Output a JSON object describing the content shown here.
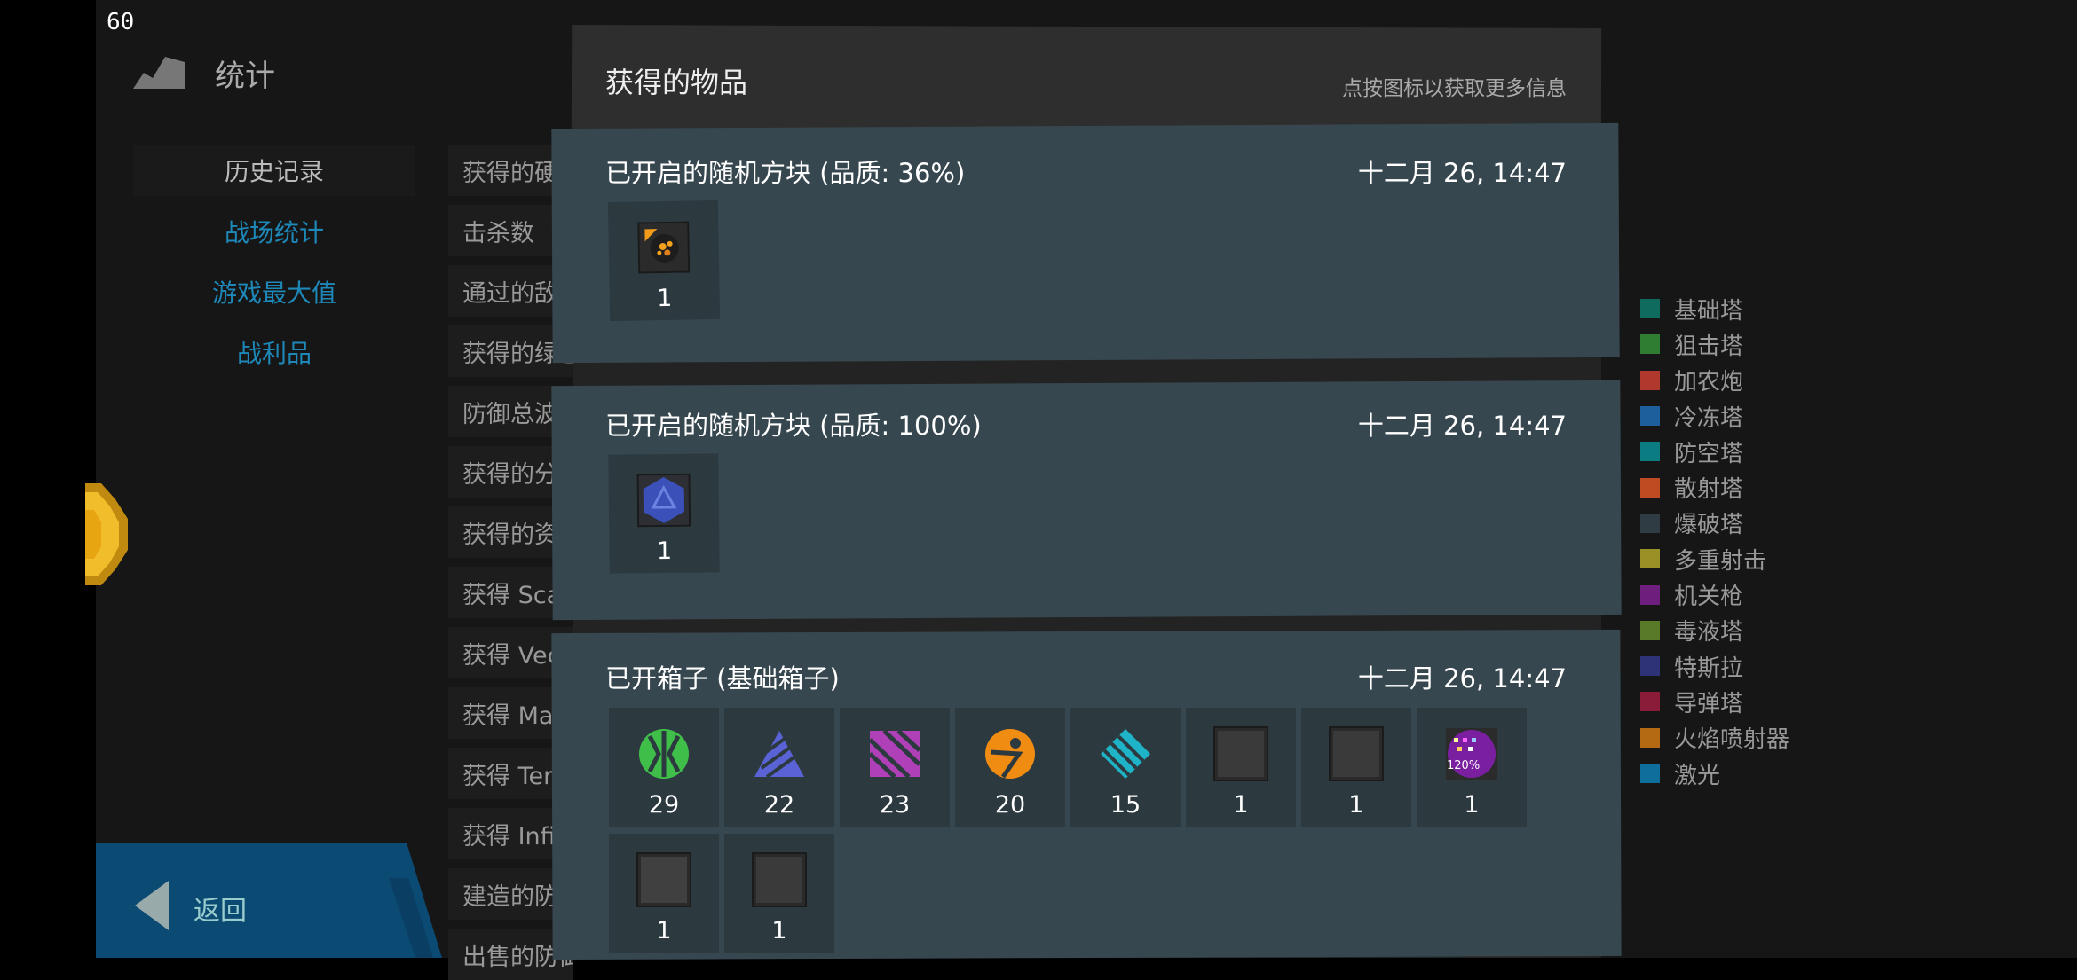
{
  "fps": "60",
  "header": {
    "title": "统计",
    "icon": "mountain-stats-icon"
  },
  "nav": {
    "items": [
      {
        "label": "历史记录",
        "active": true
      },
      {
        "label": "战场统计",
        "active": false
      },
      {
        "label": "游戏最大值",
        "active": false
      },
      {
        "label": "战利品",
        "active": false
      }
    ]
  },
  "stats_rows": [
    "获得的硬币",
    "击杀数",
    "通过的敌人",
    "获得的绿色",
    "防御总波数",
    "获得的分数",
    "获得的资源",
    "获得 Scalar",
    "获得 Vector",
    "获得 Matrix",
    "获得 Tensor",
    "获得 Infiar",
    "建造的防御塔",
    "出售的防御塔"
  ],
  "back": {
    "label": "返回",
    "icon": "back-arrow-icon"
  },
  "legend": [
    {
      "label": "基础塔",
      "color": "#0f6b5e"
    },
    {
      "label": "狙击塔",
      "color": "#2e7d32"
    },
    {
      "label": "加农炮",
      "color": "#b0382c"
    },
    {
      "label": "冷冻塔",
      "color": "#1c5f9c"
    },
    {
      "label": "防空塔",
      "color": "#0b7d82"
    },
    {
      "label": "散射塔",
      "color": "#bf4b22"
    },
    {
      "label": "爆破塔",
      "color": "#2f3c43"
    },
    {
      "label": "多重射击",
      "color": "#9a9126"
    },
    {
      "label": "机关枪",
      "color": "#6e1f7e"
    },
    {
      "label": "毒液塔",
      "color": "#587a29"
    },
    {
      "label": "特斯拉",
      "color": "#2e3378"
    },
    {
      "label": "导弹塔",
      "color": "#8a1c3a"
    },
    {
      "label": "火焰喷射器",
      "color": "#b36a12"
    },
    {
      "label": "激光",
      "color": "#0f6e9c"
    }
  ],
  "panel": {
    "title": "获得的物品",
    "hint": "点按图标以获取更多信息"
  },
  "cards": [
    {
      "title": "已开启的随机方块 (品质: 36%)",
      "date": "十二月 26, 14:47",
      "items": [
        {
          "icon": "orange-block-icon",
          "count": "1"
        }
      ]
    },
    {
      "title": "已开启的随机方块 (品质: 100%)",
      "date": "十二月 26, 14:47",
      "items": [
        {
          "icon": "blue-block-icon",
          "count": "1"
        }
      ]
    },
    {
      "title": "已开箱子 (基础箱子)",
      "date": "十二月 26, 14:47",
      "items": [
        {
          "icon": "green-resource-icon",
          "count": "29"
        },
        {
          "icon": "blue-triangle-resource-icon",
          "count": "22"
        },
        {
          "icon": "purple-stripes-resource-icon",
          "count": "23"
        },
        {
          "icon": "orange-circle-resource-icon",
          "count": "20"
        },
        {
          "icon": "cyan-resource-icon",
          "count": "15"
        },
        {
          "icon": "dark-block-icon",
          "count": "1"
        },
        {
          "icon": "dark-block-icon",
          "count": "1"
        },
        {
          "icon": "purple-modifier-icon",
          "count": "1",
          "badge": "120%"
        },
        {
          "icon": "gray-block-icon",
          "count": "1"
        },
        {
          "icon": "dark-block-icon",
          "count": "1"
        }
      ]
    }
  ]
}
